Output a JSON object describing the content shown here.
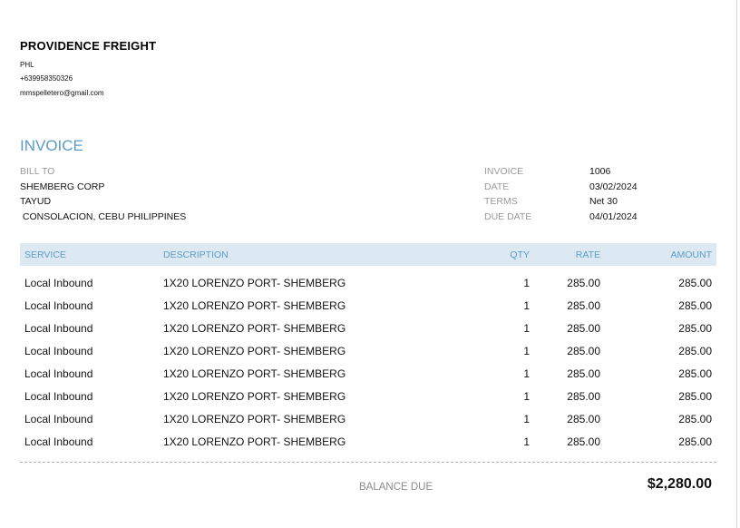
{
  "company": {
    "name": "PROVIDENCE FREIGHT",
    "location": "PHL",
    "phone": "+639958350326",
    "email": "mmspelletero@gmail.com"
  },
  "invoice_title": "INVOICE",
  "bill_to": {
    "label": "BILL TO",
    "name": "SHEMBERG CORP",
    "line1": "TAYUD",
    "line2": " CONSOLACION, CEBU PHILIPPINES"
  },
  "meta": {
    "invoice_label": "INVOICE",
    "invoice_value": "1006",
    "date_label": "DATE",
    "date_value": "03/02/2024",
    "terms_label": "TERMS",
    "terms_value": "Net 30",
    "due_label": "DUE DATE",
    "due_value": "04/01/2024"
  },
  "table": {
    "headers": {
      "service": "SERVICE",
      "description": "DESCRIPTION",
      "qty": "QTY",
      "rate": "RATE",
      "amount": "AMOUNT"
    },
    "rows": [
      {
        "service": "Local Inbound",
        "description": "1X20 LORENZO PORT- SHEMBERG",
        "qty": "1",
        "rate": "285.00",
        "amount": "285.00"
      },
      {
        "service": "Local Inbound",
        "description": "1X20 LORENZO PORT- SHEMBERG",
        "qty": "1",
        "rate": "285.00",
        "amount": "285.00"
      },
      {
        "service": "Local Inbound",
        "description": "1X20 LORENZO PORT- SHEMBERG",
        "qty": "1",
        "rate": "285.00",
        "amount": "285.00"
      },
      {
        "service": "Local Inbound",
        "description": "1X20 LORENZO PORT- SHEMBERG",
        "qty": "1",
        "rate": "285.00",
        "amount": "285.00"
      },
      {
        "service": "Local Inbound",
        "description": "1X20 LORENZO PORT- SHEMBERG",
        "qty": "1",
        "rate": "285.00",
        "amount": "285.00"
      },
      {
        "service": "Local Inbound",
        "description": "1X20 LORENZO PORT- SHEMBERG",
        "qty": "1",
        "rate": "285.00",
        "amount": "285.00"
      },
      {
        "service": "Local Inbound",
        "description": "1X20 LORENZO PORT- SHEMBERG",
        "qty": "1",
        "rate": "285.00",
        "amount": "285.00"
      },
      {
        "service": "Local Inbound",
        "description": "1X20 LORENZO PORT- SHEMBERG",
        "qty": "1",
        "rate": "285.00",
        "amount": "285.00"
      }
    ]
  },
  "balance": {
    "label": "BALANCE DUE",
    "value": "$2,280.00"
  },
  "colors": {
    "accent": "#5b9bc6",
    "header_bg": "#dde9f2",
    "muted": "#9a9a9a"
  }
}
